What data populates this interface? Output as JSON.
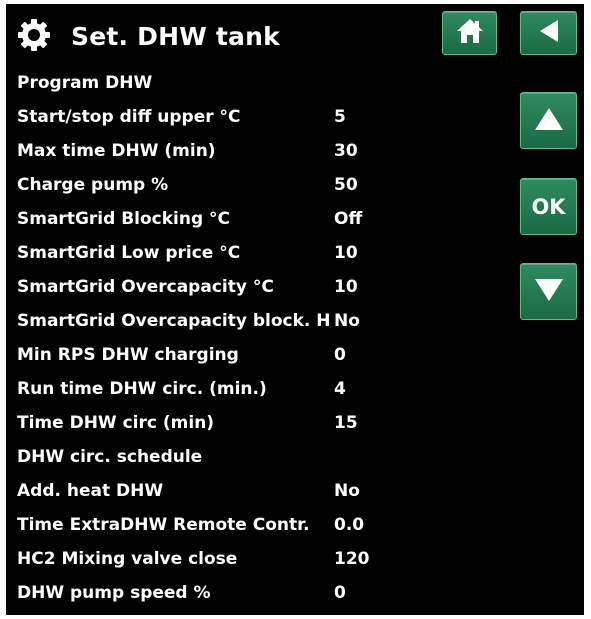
{
  "header": {
    "title": "Set. DHW tank",
    "home_icon": "home-icon",
    "back_icon": "back-arrow-icon",
    "settings_icon": "gear-icon"
  },
  "nav": {
    "up_icon": "up-arrow-icon",
    "ok_label": "OK",
    "down_icon": "down-arrow-icon"
  },
  "settings": [
    {
      "label": "Program DHW",
      "value": ""
    },
    {
      "label": "Start/stop diff upper °C",
      "value": "5"
    },
    {
      "label": "Max time DHW (min)",
      "value": "30"
    },
    {
      "label": "Charge pump %",
      "value": "50"
    },
    {
      "label": "SmartGrid Blocking °C",
      "value": "Off"
    },
    {
      "label": "SmartGrid Low price °C",
      "value": "10"
    },
    {
      "label": "SmartGrid Overcapacity °C",
      "value": "10"
    },
    {
      "label": "SmartGrid Overcapacity block. H",
      "value": "No"
    },
    {
      "label": "Min RPS DHW charging",
      "value": "0"
    },
    {
      "label": "Run time DHW circ. (min.)",
      "value": "4"
    },
    {
      "label": "Time DHW circ (min)",
      "value": "15"
    },
    {
      "label": "DHW circ. schedule",
      "value": ""
    },
    {
      "label": "Add. heat DHW",
      "value": "No"
    },
    {
      "label": "Time ExtraDHW Remote Contr.",
      "value": "0.0"
    },
    {
      "label": "HC2 Mixing valve close",
      "value": "120"
    },
    {
      "label": "DHW pump speed %",
      "value": "0"
    }
  ],
  "colors": {
    "background": "#000000",
    "text": "#ffffff",
    "button": "#1f7a50",
    "button_border": "#5fb98c"
  }
}
